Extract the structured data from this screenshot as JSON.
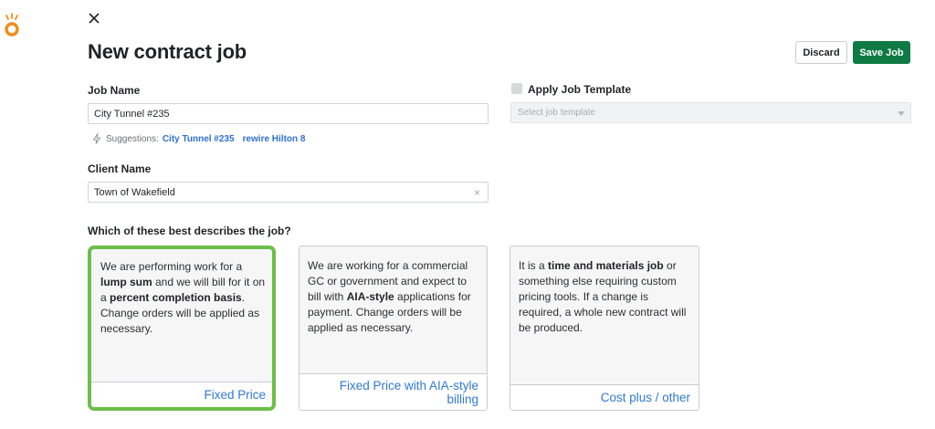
{
  "header": {
    "title": "New contract job",
    "discard_label": "Discard",
    "save_label": "Save Job"
  },
  "colors": {
    "primary_green": "#0f7a44",
    "selected_border": "#6cbf4a",
    "link_blue": "#2f6fd1",
    "logo_orange": "#f28c1b"
  },
  "icons": {
    "logo": "logo-icon",
    "close": "close-icon",
    "suggestion": "lightning-icon",
    "clear": "clear-icon",
    "dropdown": "chevron-down-icon"
  },
  "job_name": {
    "label": "Job Name",
    "value": "City Tunnel #235",
    "suggestions_label": "Suggestions:",
    "suggestions": [
      "City Tunnel #235",
      "rewire Hilton 8"
    ]
  },
  "client_name": {
    "label": "Client Name",
    "value": "Town of Wakefield",
    "clear": "×"
  },
  "template": {
    "checkbox_label": "Apply Job Template",
    "checked": false,
    "placeholder": "Select job template"
  },
  "question": "Which of these best describes the job?",
  "job_types": [
    {
      "selected": true,
      "text": [
        "We are performing work for a ",
        "lump sum",
        " and we will bill for it on a ",
        "percent completion basis",
        ". Change orders will be applied as necessary."
      ],
      "label": "Fixed Price"
    },
    {
      "selected": false,
      "text": [
        "We are working for a commercial GC or government and expect to bill with ",
        "AIA-style",
        " applications for payment. Change orders will be applied as necessary."
      ],
      "label": "Fixed Price with AIA-style billing"
    },
    {
      "selected": false,
      "text": [
        "It is a ",
        "time and materials job",
        " or something else requiring custom pricing tools. If a change is required, a whole new contract will be produced."
      ],
      "label": "Cost plus / other"
    }
  ]
}
